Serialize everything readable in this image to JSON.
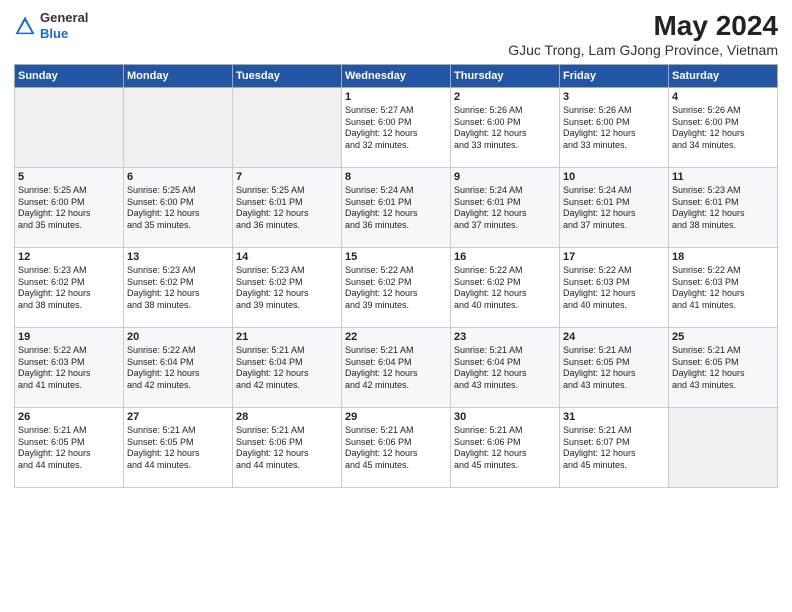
{
  "header": {
    "logo_general": "General",
    "logo_blue": "Blue",
    "main_title": "May 2024",
    "subtitle": "GJuc Trong, Lam GJong Province, Vietnam"
  },
  "days_of_week": [
    "Sunday",
    "Monday",
    "Tuesday",
    "Wednesday",
    "Thursday",
    "Friday",
    "Saturday"
  ],
  "weeks": [
    [
      {
        "day": "",
        "info": ""
      },
      {
        "day": "",
        "info": ""
      },
      {
        "day": "",
        "info": ""
      },
      {
        "day": "1",
        "info": "Sunrise: 5:27 AM\nSunset: 6:00 PM\nDaylight: 12 hours\nand 32 minutes."
      },
      {
        "day": "2",
        "info": "Sunrise: 5:26 AM\nSunset: 6:00 PM\nDaylight: 12 hours\nand 33 minutes."
      },
      {
        "day": "3",
        "info": "Sunrise: 5:26 AM\nSunset: 6:00 PM\nDaylight: 12 hours\nand 33 minutes."
      },
      {
        "day": "4",
        "info": "Sunrise: 5:26 AM\nSunset: 6:00 PM\nDaylight: 12 hours\nand 34 minutes."
      }
    ],
    [
      {
        "day": "5",
        "info": "Sunrise: 5:25 AM\nSunset: 6:00 PM\nDaylight: 12 hours\nand 35 minutes."
      },
      {
        "day": "6",
        "info": "Sunrise: 5:25 AM\nSunset: 6:00 PM\nDaylight: 12 hours\nand 35 minutes."
      },
      {
        "day": "7",
        "info": "Sunrise: 5:25 AM\nSunset: 6:01 PM\nDaylight: 12 hours\nand 36 minutes."
      },
      {
        "day": "8",
        "info": "Sunrise: 5:24 AM\nSunset: 6:01 PM\nDaylight: 12 hours\nand 36 minutes."
      },
      {
        "day": "9",
        "info": "Sunrise: 5:24 AM\nSunset: 6:01 PM\nDaylight: 12 hours\nand 37 minutes."
      },
      {
        "day": "10",
        "info": "Sunrise: 5:24 AM\nSunset: 6:01 PM\nDaylight: 12 hours\nand 37 minutes."
      },
      {
        "day": "11",
        "info": "Sunrise: 5:23 AM\nSunset: 6:01 PM\nDaylight: 12 hours\nand 38 minutes."
      }
    ],
    [
      {
        "day": "12",
        "info": "Sunrise: 5:23 AM\nSunset: 6:02 PM\nDaylight: 12 hours\nand 38 minutes."
      },
      {
        "day": "13",
        "info": "Sunrise: 5:23 AM\nSunset: 6:02 PM\nDaylight: 12 hours\nand 38 minutes."
      },
      {
        "day": "14",
        "info": "Sunrise: 5:23 AM\nSunset: 6:02 PM\nDaylight: 12 hours\nand 39 minutes."
      },
      {
        "day": "15",
        "info": "Sunrise: 5:22 AM\nSunset: 6:02 PM\nDaylight: 12 hours\nand 39 minutes."
      },
      {
        "day": "16",
        "info": "Sunrise: 5:22 AM\nSunset: 6:02 PM\nDaylight: 12 hours\nand 40 minutes."
      },
      {
        "day": "17",
        "info": "Sunrise: 5:22 AM\nSunset: 6:03 PM\nDaylight: 12 hours\nand 40 minutes."
      },
      {
        "day": "18",
        "info": "Sunrise: 5:22 AM\nSunset: 6:03 PM\nDaylight: 12 hours\nand 41 minutes."
      }
    ],
    [
      {
        "day": "19",
        "info": "Sunrise: 5:22 AM\nSunset: 6:03 PM\nDaylight: 12 hours\nand 41 minutes."
      },
      {
        "day": "20",
        "info": "Sunrise: 5:22 AM\nSunset: 6:04 PM\nDaylight: 12 hours\nand 42 minutes."
      },
      {
        "day": "21",
        "info": "Sunrise: 5:21 AM\nSunset: 6:04 PM\nDaylight: 12 hours\nand 42 minutes."
      },
      {
        "day": "22",
        "info": "Sunrise: 5:21 AM\nSunset: 6:04 PM\nDaylight: 12 hours\nand 42 minutes."
      },
      {
        "day": "23",
        "info": "Sunrise: 5:21 AM\nSunset: 6:04 PM\nDaylight: 12 hours\nand 43 minutes."
      },
      {
        "day": "24",
        "info": "Sunrise: 5:21 AM\nSunset: 6:05 PM\nDaylight: 12 hours\nand 43 minutes."
      },
      {
        "day": "25",
        "info": "Sunrise: 5:21 AM\nSunset: 6:05 PM\nDaylight: 12 hours\nand 43 minutes."
      }
    ],
    [
      {
        "day": "26",
        "info": "Sunrise: 5:21 AM\nSunset: 6:05 PM\nDaylight: 12 hours\nand 44 minutes."
      },
      {
        "day": "27",
        "info": "Sunrise: 5:21 AM\nSunset: 6:05 PM\nDaylight: 12 hours\nand 44 minutes."
      },
      {
        "day": "28",
        "info": "Sunrise: 5:21 AM\nSunset: 6:06 PM\nDaylight: 12 hours\nand 44 minutes."
      },
      {
        "day": "29",
        "info": "Sunrise: 5:21 AM\nSunset: 6:06 PM\nDaylight: 12 hours\nand 45 minutes."
      },
      {
        "day": "30",
        "info": "Sunrise: 5:21 AM\nSunset: 6:06 PM\nDaylight: 12 hours\nand 45 minutes."
      },
      {
        "day": "31",
        "info": "Sunrise: 5:21 AM\nSunset: 6:07 PM\nDaylight: 12 hours\nand 45 minutes."
      },
      {
        "day": "",
        "info": ""
      }
    ]
  ]
}
